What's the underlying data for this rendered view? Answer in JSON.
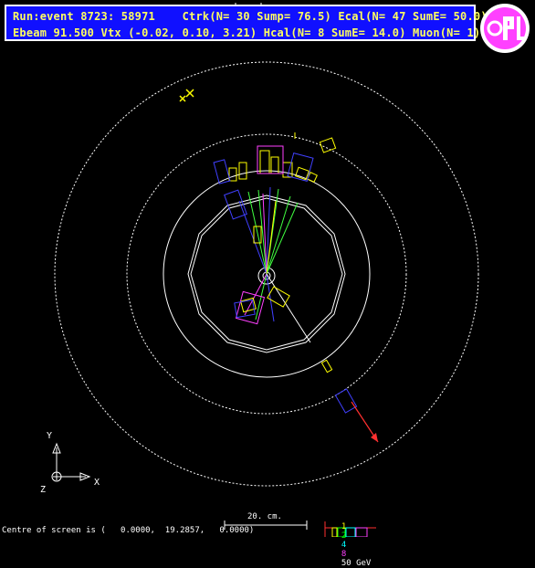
{
  "header": {
    "line1": "Run:event 8723: 58971    Ctrk(N= 30 Sump= 76.5) Ecal(N= 47 SumE= 50.0)",
    "line2": "Ebeam 91.500 Vtx (-0.02, 0.10, 3.21) Hcal(N= 8 SumE= 14.0) Muon(N= 1)"
  },
  "logo": {
    "text": "OPAL"
  },
  "axes": {
    "y_label": "Y",
    "x_label": "X",
    "z_label": "Z"
  },
  "footer": {
    "centre_text": "Centre of screen is (   0.0000,  19.2857,   0.0000)",
    "scale_label": "20. cm.",
    "energy_scale": {
      "values": [
        "1",
        "2",
        "4",
        "8",
        "50 GeV"
      ],
      "colors": [
        "#ffff00",
        "#00ff00",
        "#00ffff",
        "#ff40ff",
        "#ffffff"
      ]
    }
  },
  "colors": {
    "header_bg": "#1010ff",
    "header_text": "#ffff60",
    "track_green": "#40ff40",
    "track_blue": "#4040ff",
    "ecal": "#ffff00",
    "hcal": "#ff40ff",
    "muon": "#ff3030"
  }
}
